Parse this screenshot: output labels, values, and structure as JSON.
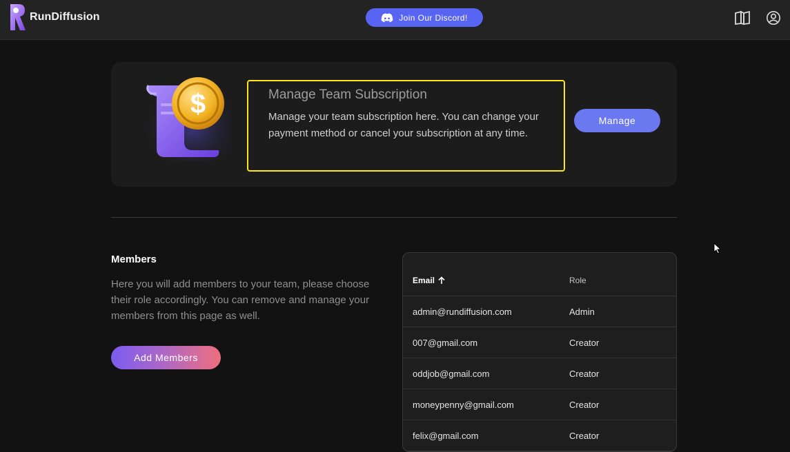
{
  "app": {
    "name": "RunDiffusion"
  },
  "header": {
    "discord_label": "Join Our Discord!",
    "icons": [
      "docs-book-icon",
      "account-icon",
      "discord-icon"
    ]
  },
  "subscription": {
    "title": "Manage Team Subscription",
    "description": "Manage your team subscription here. You can change your payment method or cancel your subscription at any time.",
    "manage_label": "Manage",
    "highlight_color": "#ffe812"
  },
  "members": {
    "title": "Members",
    "description": "Here you will add members to your team, please choose their role accordingly. You can remove and manage your members from this page as well.",
    "add_label": "Add Members",
    "table": {
      "columns": [
        "Email",
        "Role"
      ],
      "sort": {
        "column": "Email",
        "direction": "ascending"
      },
      "rows": [
        {
          "email": "admin@rundiffusion.com",
          "role": "Admin"
        },
        {
          "email": "007@gmail.com",
          "role": "Creator"
        },
        {
          "email": "oddjob@gmail.com",
          "role": "Creator"
        },
        {
          "email": "moneypenny@gmail.com",
          "role": "Creator"
        },
        {
          "email": "felix@gmail.com",
          "role": "Creator"
        }
      ]
    }
  },
  "colors": {
    "accent": "#5865f2",
    "manage_button": "#6b79f0",
    "add_gradient": [
      "#7b5cf0",
      "#ef6f7d"
    ],
    "background": "#121212",
    "card": "#1c1c1c"
  }
}
